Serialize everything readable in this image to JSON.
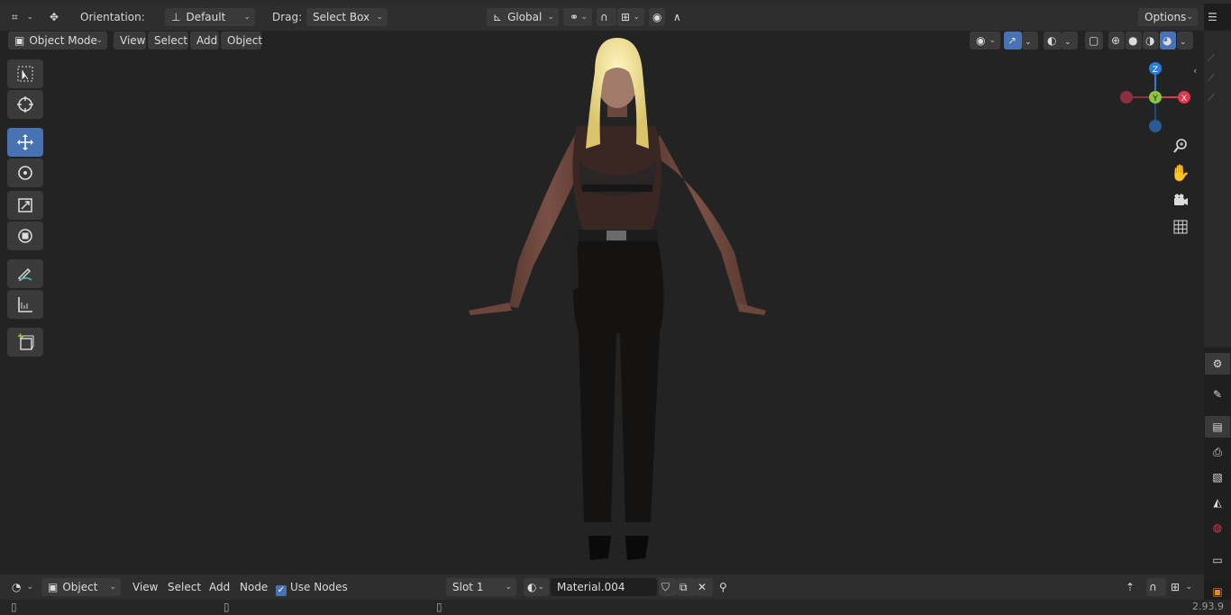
{
  "header": {
    "orientation_label": "Orientation:",
    "orientation_value": "Default",
    "drag_label": "Drag:",
    "drag_value": "Select Box",
    "transform_space": "Global",
    "options_label": "Options"
  },
  "viewport_header": {
    "mode": "Object Mode",
    "menus": [
      "View",
      "Select",
      "Add",
      "Object"
    ]
  },
  "gizmo": {
    "z": "Z",
    "y": "Y",
    "x": "X"
  },
  "shader_header": {
    "type": "Object",
    "menus": [
      "View",
      "Select",
      "Add",
      "Node"
    ],
    "use_nodes_label": "Use Nodes",
    "use_nodes_checked": true,
    "slot": "Slot 1",
    "material": "Material.004"
  },
  "status": {
    "version": "2.93.9"
  },
  "colors": {
    "accent": "#4772b3",
    "axis_x": "#e0374d",
    "axis_y": "#8cc63f",
    "axis_z": "#2a7ed8"
  }
}
